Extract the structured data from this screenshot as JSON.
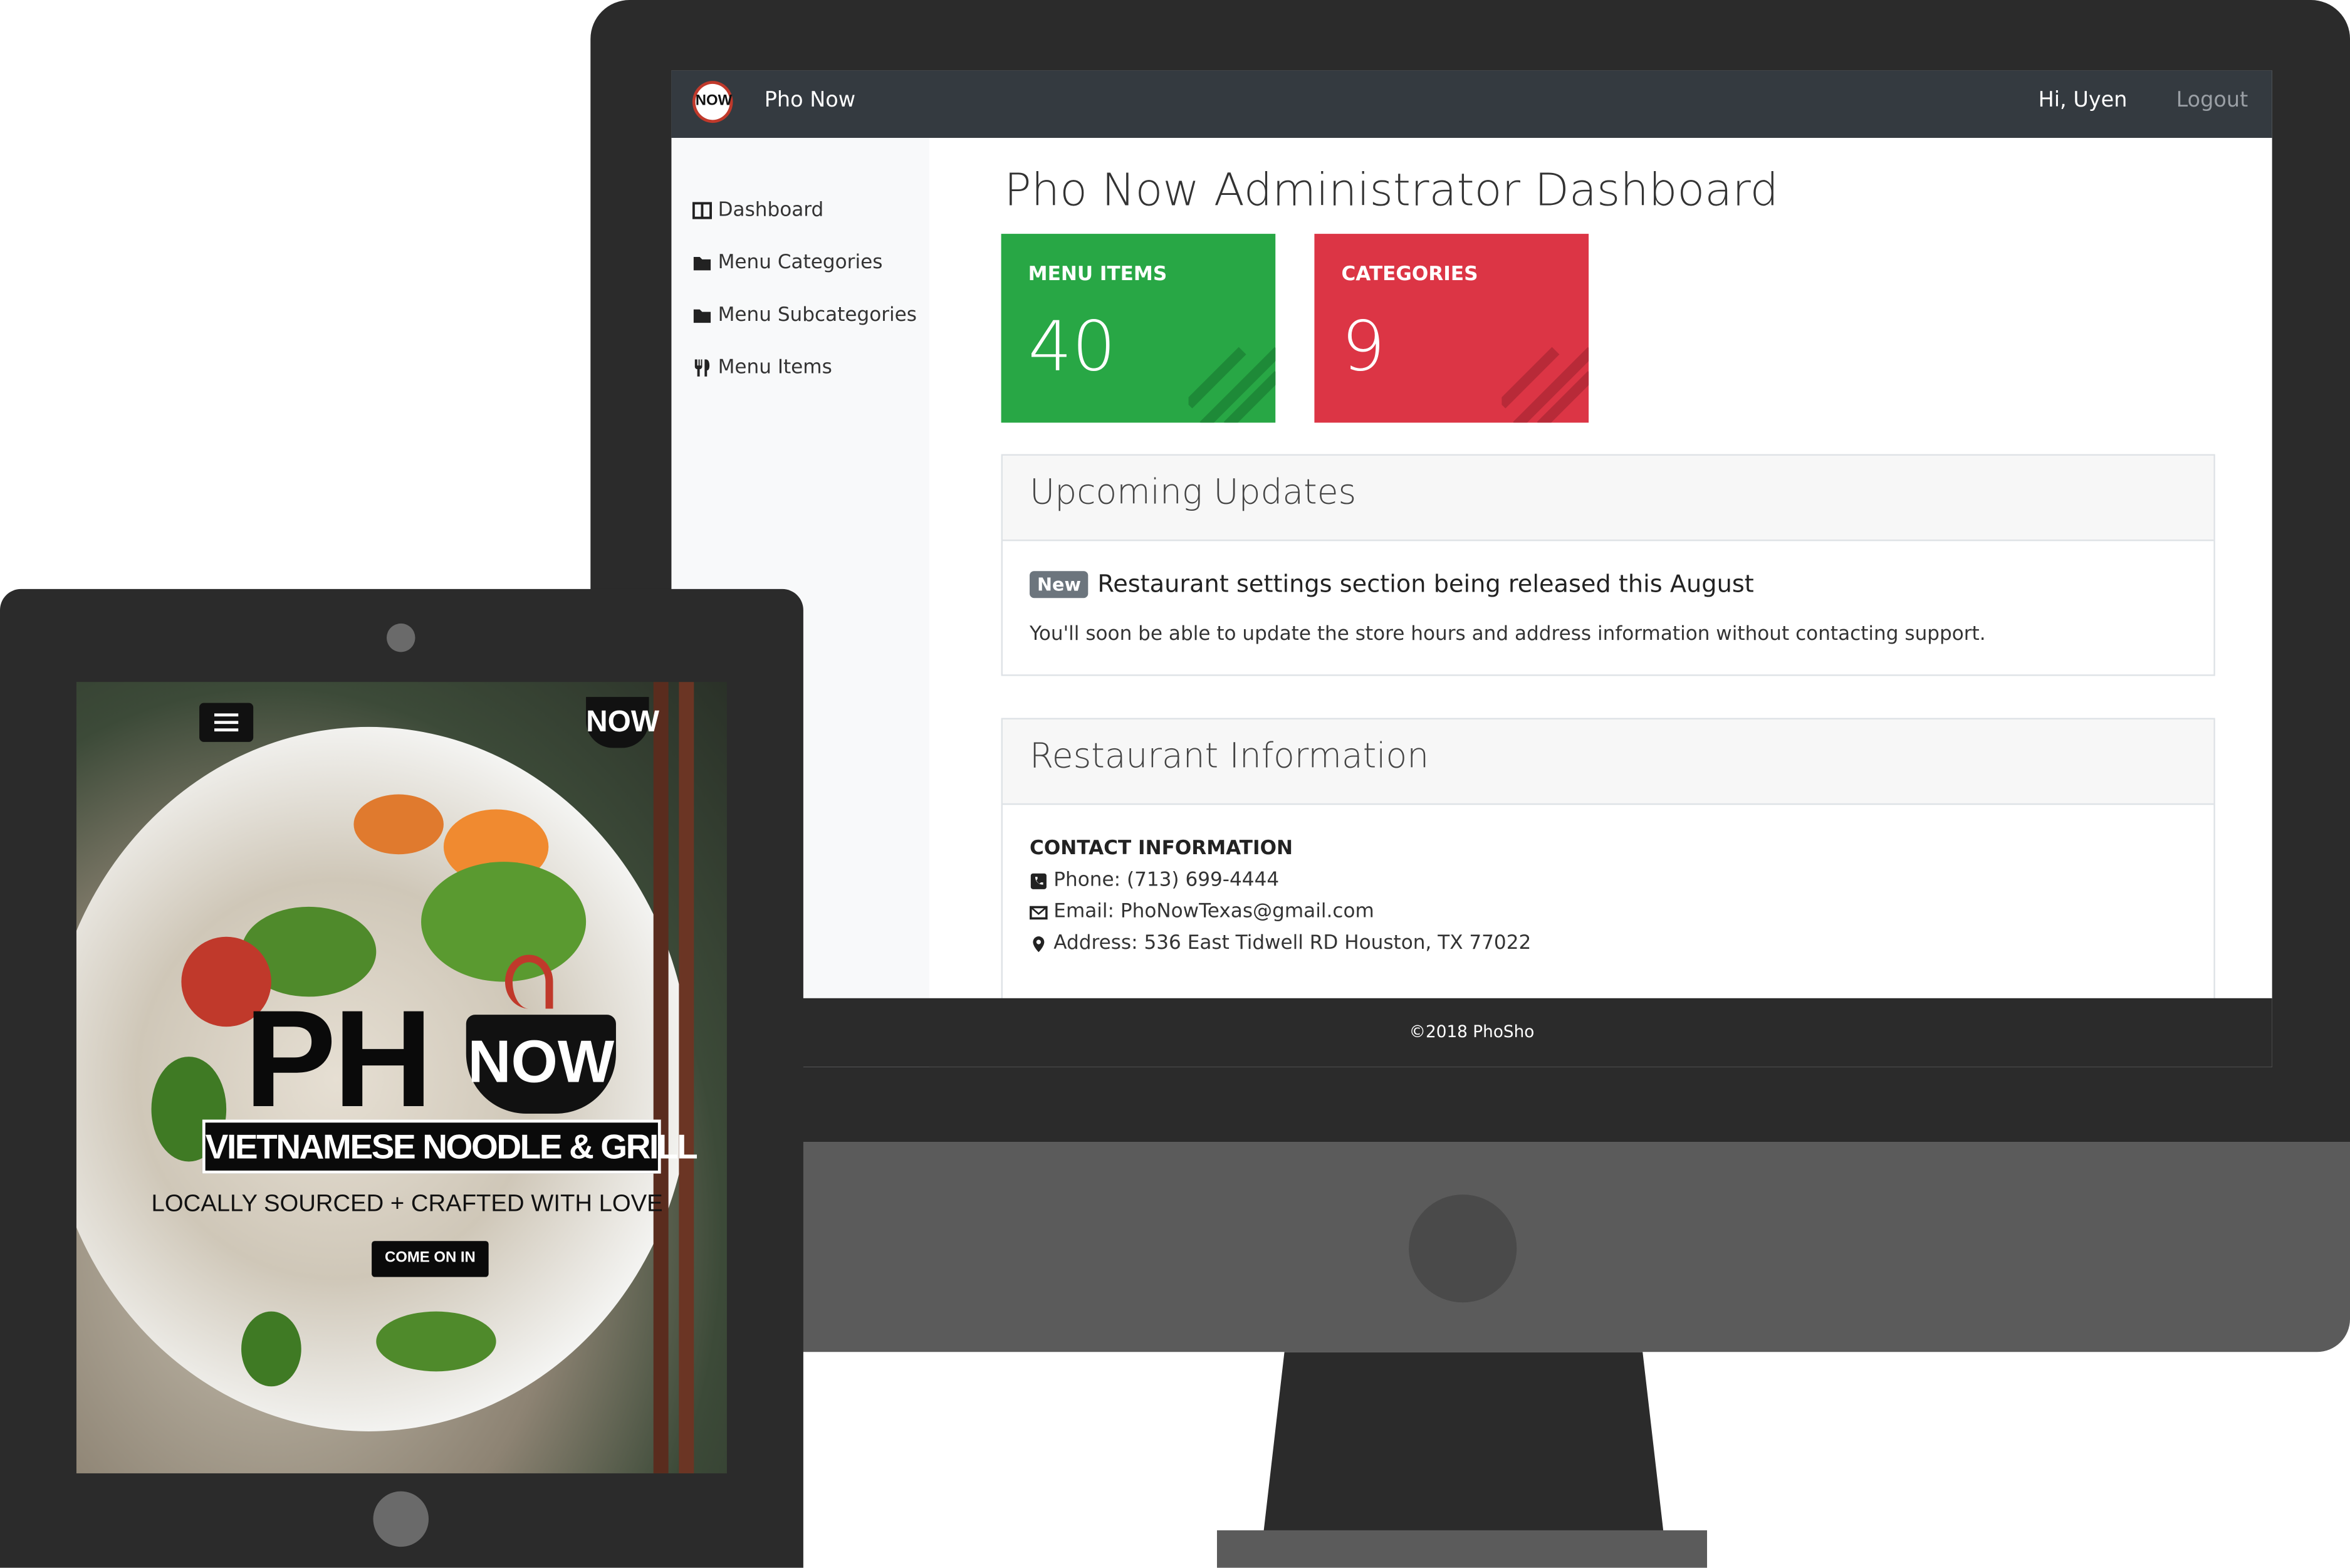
{
  "navbar": {
    "logo_text": "NOW",
    "brand": "Pho Now",
    "greeting": "Hi, Uyen",
    "logout_label": "Logout",
    "bg_color": "#343a40"
  },
  "sidebar": {
    "items": [
      {
        "label": "Dashboard",
        "icon": "columns-icon"
      },
      {
        "label": "Menu Categories",
        "icon": "folder-icon"
      },
      {
        "label": "Menu Subcategories",
        "icon": "folder-icon"
      },
      {
        "label": "Menu Items",
        "icon": "utensils-icon"
      }
    ]
  },
  "main": {
    "title": "Pho Now Administrator Dashboard",
    "stats": [
      {
        "label": "MENU ITEMS",
        "value": "40",
        "color": "#28a745"
      },
      {
        "label": "CATEGORIES",
        "value": "9",
        "color": "#dc3545"
      }
    ],
    "updates": {
      "heading": "Upcoming Updates",
      "badge": "New",
      "title": "Restaurant settings section being released this August",
      "text": "You'll soon be able to update the store hours and address information without contacting support."
    },
    "restaurant": {
      "heading": "Restaurant Information",
      "contact_heading": "CONTACT INFORMATION",
      "phone": "Phone: (713) 699-4444",
      "email": "Email: PhoNowTexas@gmail.com",
      "address": "Address: 536 East Tidwell RD Houston, TX 77022"
    }
  },
  "footer": {
    "text": "©2018 PhoSho"
  },
  "tablet": {
    "logo_now": "NOW",
    "hero_ph": "PH",
    "hero_now": "NOW",
    "subtitle": "VIETNAMESE NOODLE & GRILL",
    "tagline": "LOCALLY SOURCED + CRAFTED WITH LOVE",
    "cta": "COME ON IN"
  }
}
